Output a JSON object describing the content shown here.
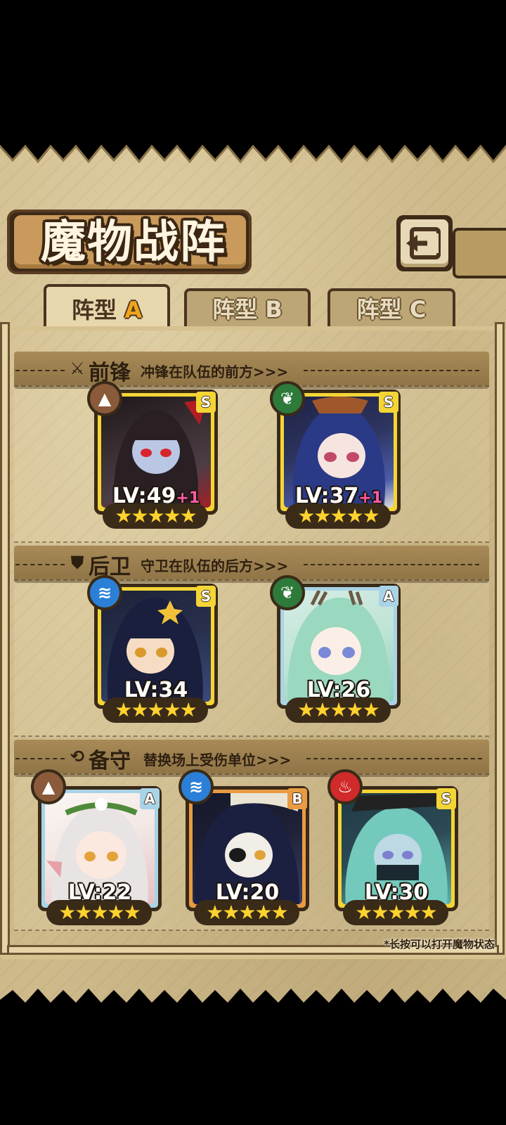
{
  "header": {
    "title": "魔物战阵",
    "back_button": "back-icon"
  },
  "tabs": [
    {
      "prefix": "阵型",
      "letter": "A",
      "active": true
    },
    {
      "prefix": "阵型",
      "letter": "B",
      "active": false
    },
    {
      "prefix": "阵型",
      "letter": "C",
      "active": false
    }
  ],
  "sections": {
    "vanguard": {
      "title": "前锋",
      "description": "冲锋在队伍的前方>>>",
      "icon": "sword-icon"
    },
    "rearguard": {
      "title": "后卫",
      "description": "守卫在队伍的后方>>>",
      "icon": "shield-icon"
    },
    "reserve": {
      "title": "备守",
      "description": "替换场上受伤单位>>>",
      "icon": "swap-icon"
    }
  },
  "units": {
    "vanguard": [
      {
        "level": "LV:49",
        "bonus": "+1",
        "rank": "S",
        "element": "earth",
        "stars": "★★★★★",
        "colors": {
          "bg": "#3a2f33",
          "accent": "#c0202a"
        }
      },
      {
        "level": "LV:37",
        "bonus": "+1",
        "rank": "S",
        "element": "wind",
        "stars": "★★★★★",
        "colors": {
          "bg": "#2d3560",
          "accent": "#5a6fc7"
        }
      }
    ],
    "rearguard": [
      {
        "level": "LV:34",
        "rank": "S",
        "element": "water",
        "stars": "★★★★★",
        "colors": {
          "bg": "#28304d",
          "accent": "#f0c27a"
        }
      },
      {
        "level": "LV:26",
        "rank": "A",
        "element": "wind",
        "stars": "★★★★★",
        "colors": {
          "bg": "#bfe4d6",
          "accent": "#8fd0b9"
        }
      }
    ],
    "reserve": [
      {
        "level": "LV:22",
        "rank": "A",
        "element": "earth",
        "stars": "★★★★★",
        "colors": {
          "bg": "#f1e6e3",
          "accent": "#e6a0a8"
        }
      },
      {
        "level": "LV:20",
        "rank": "B",
        "element": "water",
        "stars": "★★★★★",
        "colors": {
          "bg": "#1f2238",
          "accent": "#e9e4d4"
        }
      },
      {
        "level": "LV:30",
        "rank": "S",
        "element": "fire",
        "stars": "★★★★★",
        "colors": {
          "bg": "#2c4a56",
          "accent": "#7fd0c8"
        }
      }
    ]
  },
  "footnote": "*长按可以打开魔物状态"
}
